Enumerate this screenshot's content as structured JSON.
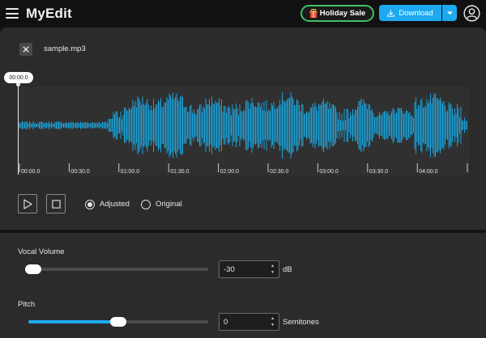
{
  "app": {
    "title": "MyEdit"
  },
  "header": {
    "sale_label": "Holiday Sale",
    "download_label": "Download",
    "icons": [
      "hamburger-icon",
      "gift-icon",
      "download-icon",
      "chevron-down-icon",
      "user-icon"
    ]
  },
  "file": {
    "name": "sample.mp3"
  },
  "player": {
    "current_time": "00:00.0",
    "timeline_labels": [
      "00:00.0",
      "00:30.0",
      "01:00.0",
      "01:30.0",
      "02:00.0",
      "02:30.0",
      "03:00.0",
      "03:30.0",
      "04:00.0"
    ],
    "modes": [
      {
        "label": "Adjusted",
        "selected": true
      },
      {
        "label": "Original",
        "selected": false
      }
    ]
  },
  "vocal_volume": {
    "label": "Vocal Volume",
    "value": "-30",
    "unit": "dB",
    "level_fraction": 0.0
  },
  "pitch": {
    "label": "Pitch",
    "value": "0",
    "unit": "Semitones",
    "level_fraction": 0.5
  },
  "colors": {
    "accent": "#1eaaf1",
    "waveform": "#1aa3dc",
    "sale_border": "#3ec167",
    "panel": "#2b2b2b",
    "background": "#111111"
  }
}
